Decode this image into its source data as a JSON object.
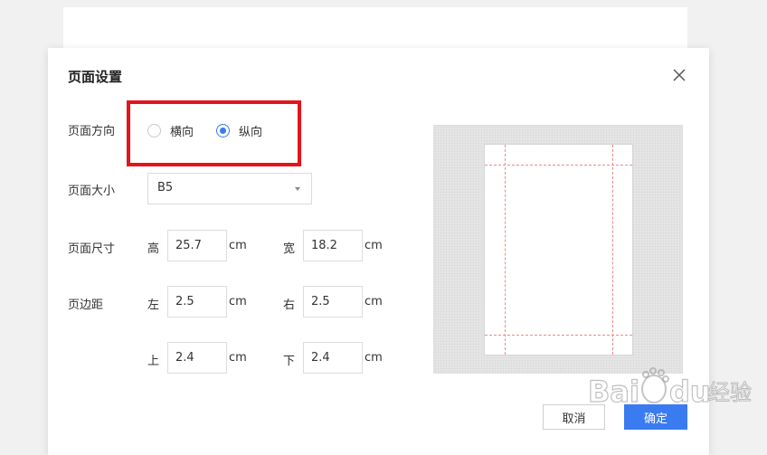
{
  "dialog": {
    "title": "页面设置"
  },
  "orientation": {
    "label": "页面方向",
    "options": [
      {
        "label": "横向",
        "checked": false
      },
      {
        "label": "纵向",
        "checked": true
      }
    ]
  },
  "size": {
    "label": "页面大小",
    "selected": "B5"
  },
  "dimensions": {
    "label": "页面尺寸",
    "height_label": "高",
    "height_value": "25.7",
    "width_label": "宽",
    "width_value": "18.2",
    "unit": "cm"
  },
  "margins": {
    "label": "页边距",
    "left_label": "左",
    "left_value": "2.5",
    "right_label": "右",
    "right_value": "2.5",
    "top_label": "上",
    "top_value": "2.4",
    "bottom_label": "下",
    "bottom_value": "2.4",
    "unit": "cm"
  },
  "buttons": {
    "cancel": "取消",
    "ok": "确定"
  },
  "colors": {
    "accent": "#3a7bf0",
    "highlight": "#e3141b",
    "margin_guide": "#f08a8a"
  },
  "watermark": {
    "text": "Bai du 经验"
  }
}
